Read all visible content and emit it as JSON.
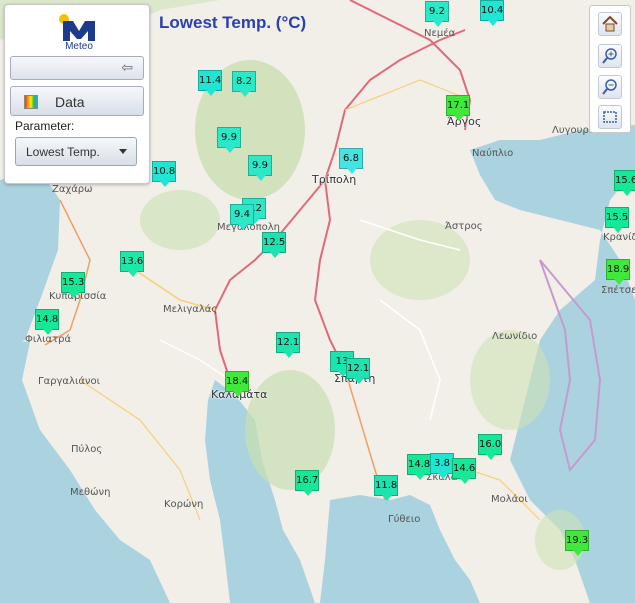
{
  "header": {
    "title": "Lowest Temp. (°C)"
  },
  "panel": {
    "logo_text": "Meteo",
    "data_button_label": "Data",
    "parameter_label": "Parameter:",
    "parameter_value": "Lowest Temp."
  },
  "toolbar": {
    "items": [
      "home-icon",
      "zoom-in-icon",
      "zoom-out-icon",
      "zoom-box-icon"
    ]
  },
  "colors": {
    "cool": "#1ee6d2",
    "mid": "#16e898",
    "warm": "#3fe83a",
    "sea": "#aad3df",
    "land": "#f2efe9",
    "forest": "#c8dfb0"
  },
  "place_labels": [
    "Νεμέα",
    "Άργος",
    "Λυγουριό",
    "Ναύπλιο",
    "Ζαχάρω",
    "Τρίπολη",
    "Μεγαλόπολη",
    "Άστρος",
    "Κυπαρισσία",
    "Μελιγαλάς",
    "Φιλιατρά",
    "Λεωνίδιο",
    "Γαργαλιάνοι",
    "Καλαμάτα",
    "Σπάρτη",
    "Πύλος",
    "Μεθώνη",
    "Κορώνη",
    "Γύθειο",
    "Μολάοι",
    "Σκάλα",
    "Κρανίδι",
    "Σπέτσες"
  ],
  "stations": [
    "9.2",
    "10.4",
    "11.4",
    "8.2",
    "17.1",
    "9.9",
    "6.8",
    "10.8",
    "9.9",
    "15.6",
    "8.2",
    "9.4",
    "15.5",
    "12.5",
    "13.6",
    "18.9",
    "15.3",
    "14.8",
    "12.1",
    "13",
    "12.1",
    "18.4",
    "16.0",
    "14.8",
    "3.8",
    "14.6",
    "16.7",
    "11.8",
    "19.3"
  ]
}
